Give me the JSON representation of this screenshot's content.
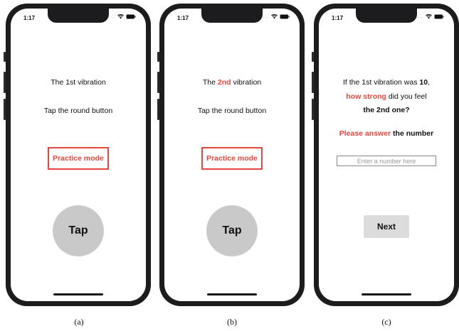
{
  "captions": [
    "(a)",
    "(b)",
    "(c)"
  ],
  "status_bar": {
    "time": "1:17",
    "signal": "....",
    "wifi_icon": "wifi-icon",
    "battery_icon": "battery-icon"
  },
  "screen_a": {
    "title_prefix": "The 1st vibration",
    "instruction": "Tap the round button",
    "practice_label": "Practice mode",
    "tap_label": "Tap"
  },
  "screen_b": {
    "title_prefix": "The ",
    "title_highlight": "2nd",
    "title_suffix": " vibration",
    "instruction": "Tap the round button",
    "practice_label": "Practice mode",
    "tap_label": "Tap"
  },
  "screen_c": {
    "q1_prefix": "If the 1st vibration was ",
    "q1_value": "10",
    "q1_suffix": ",",
    "q2_highlight": "how strong",
    "q2_suffix": " did you feel",
    "q3": "the 2nd one?",
    "prompt_highlight": "Please answer",
    "prompt_suffix": " the number",
    "input_value": "",
    "input_placeholder": "Enter a number here",
    "next_label": "Next"
  },
  "colors": {
    "accent": "#e8453c",
    "button_gray": "#c9c9c9",
    "frame": "#1c1c1e"
  }
}
